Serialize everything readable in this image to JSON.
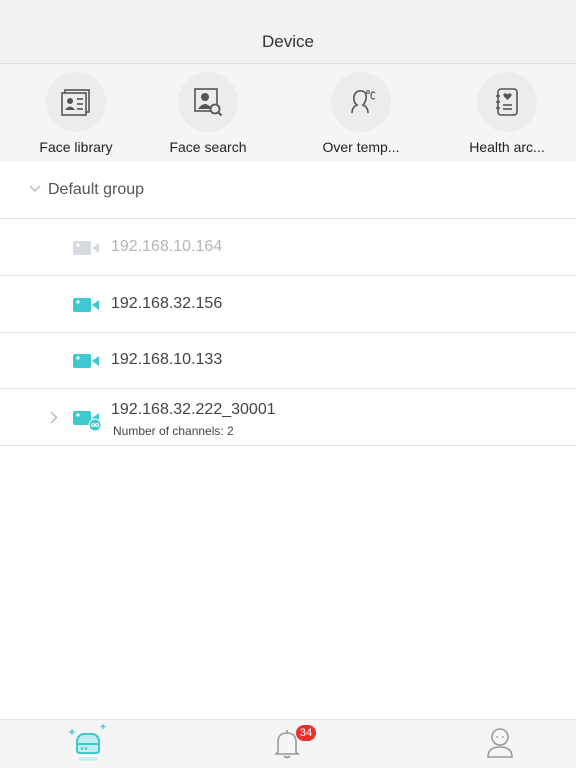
{
  "header": {
    "title": "Device"
  },
  "features": [
    {
      "label": "Face library",
      "icon": "face-library-icon"
    },
    {
      "label": "Face search",
      "icon": "face-search-icon"
    },
    {
      "label": "Over temp...",
      "icon": "over-temperature-icon"
    },
    {
      "label": "Health arc...",
      "icon": "health-archive-icon"
    }
  ],
  "group": {
    "label": "Default group",
    "expanded": true
  },
  "devices": [
    {
      "ip": "192.168.10.164",
      "status": "offline"
    },
    {
      "ip": "192.168.32.156",
      "status": "online"
    },
    {
      "ip": "192.168.10.133",
      "status": "online"
    },
    {
      "ip": "192.168.32.222_30001",
      "subtitle": "Number of channels: 2",
      "status": "online"
    }
  ],
  "tabbar": {
    "tabs": [
      {
        "name": "device-tab",
        "icon": "device-icon",
        "active": true
      },
      {
        "name": "notifications-tab",
        "icon": "bell-icon",
        "badge": "34"
      },
      {
        "name": "profile-tab",
        "icon": "user-icon"
      }
    ]
  },
  "colors": {
    "accent": "#3ec8cf",
    "offline": "#d6d9df",
    "badge": "#e8312f",
    "header_bg": "#f2f2f3"
  }
}
